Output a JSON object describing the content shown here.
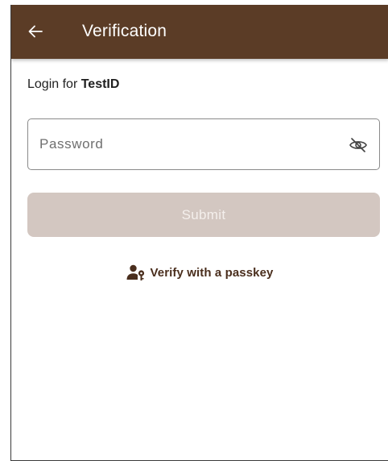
{
  "app_bar": {
    "title": "Verification",
    "back_icon": "arrow-left-icon",
    "background_color": "#5b3c26"
  },
  "login": {
    "prefix": "Login for ",
    "account": "TestID"
  },
  "password_field": {
    "placeholder": "Password",
    "value": "",
    "toggle_icon": "eye-off-icon"
  },
  "submit": {
    "label": "Submit",
    "state": "disabled",
    "background_color": "#d3c7c1"
  },
  "passkey": {
    "label": "Verify with a passkey",
    "icon": "person-key-icon",
    "color": "#4a2e1d"
  }
}
